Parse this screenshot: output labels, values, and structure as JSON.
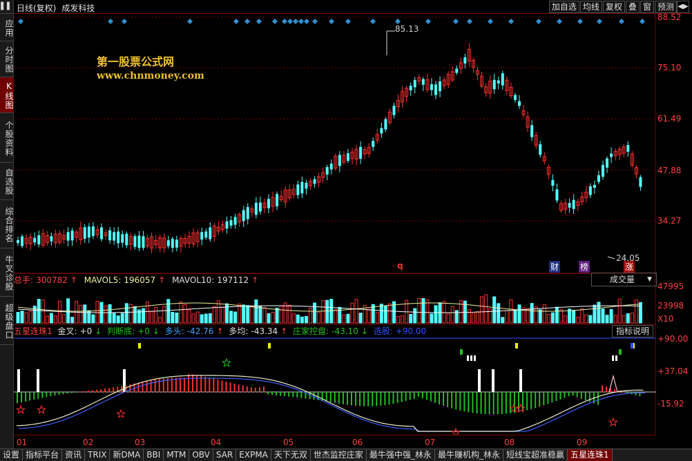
{
  "sidebar": {
    "items": [
      {
        "label": "应用"
      },
      {
        "label": "分时图"
      },
      {
        "label": "K线图"
      },
      {
        "label": "个股资料"
      },
      {
        "label": "自选股"
      },
      {
        "label": "综合排名"
      },
      {
        "label": "牛叉诊股"
      },
      {
        "label": "超级盘口"
      }
    ]
  },
  "topbar": {
    "period": "日线(复权)",
    "stock": "成发科技",
    "buttons": [
      "加自选",
      "均线",
      "复权",
      "叠",
      "窗",
      "预测"
    ],
    "arrow": "◀▶"
  },
  "watermark": {
    "title": "第一股票公式网",
    "url": "www.chnmoney.com"
  },
  "price_axis": [
    "88.52",
    "75.10",
    "61.49",
    "47.88",
    "34.27"
  ],
  "price_annotations": {
    "high": "85.13",
    "low": "24.05"
  },
  "event_marks": {
    "q": "q",
    "cai": "财",
    "bang": "榜",
    "zhang": "涨"
  },
  "volume": {
    "label": "总手",
    "value": "300782",
    "ma5_label": "MAVOL5",
    "ma5_value": "196057",
    "ma10_label": "MAVOL10",
    "ma10_value": "197112",
    "axis": [
      "47995",
      "23998",
      "X10"
    ],
    "selector": "成交量"
  },
  "indicator": {
    "name": "五星连珠1",
    "jincha_label": "金叉",
    "jincha_value": "+0",
    "panduan_label": "判断底",
    "panduan_value": "+0",
    "duotou_label": "多头",
    "duotou_value": "-42.76",
    "duojun_label": "多均",
    "duojun_value": "-43.34",
    "zhuangjia_label": "庄家控盘",
    "zhuangjia_value": "-43.10",
    "xuangu_label": "选股",
    "xuangu_value": "+90.00",
    "axis": [
      "+90.00",
      "+37.04",
      "-15.92"
    ],
    "explain_button": "指标说明"
  },
  "date_axis": [
    "01",
    "02",
    "03",
    "04",
    "05",
    "06",
    "07",
    "08",
    "09"
  ],
  "bottom_tabs": [
    "设置",
    "指标平台",
    "资讯",
    "TRIX",
    "新DMA",
    "BBI",
    "MTM",
    "OBV",
    "SAR",
    "EXPMA",
    "天下无双",
    "世杰监控庄家",
    "最牛强中强_林永",
    "最牛赚机构_林永",
    "短线宝超准稳赢",
    "五星连珠1"
  ],
  "colors": {
    "up": "#ff3030",
    "down": "#54ffff",
    "axis_red": "#ff4040",
    "gold": "#f0c030",
    "ma_white": "#e8e8e8",
    "ma_blue": "#4060ff",
    "green_bar": "#20c020"
  }
}
